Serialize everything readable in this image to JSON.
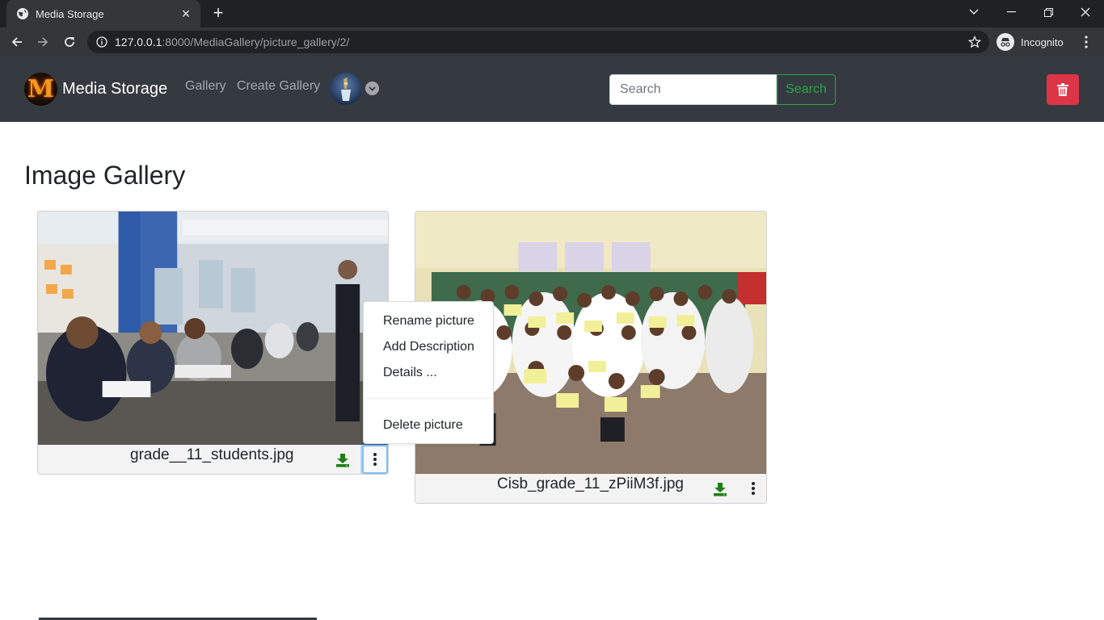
{
  "browser": {
    "tab_title": "Media Storage",
    "url_host": "127.0.0.1",
    "url_rest": ":8000/MediaGallery/picture_gallery/2/",
    "incognito_label": "Incognito"
  },
  "navbar": {
    "brand_letter": "M",
    "brand_name": "Media Storage",
    "links": [
      "Gallery",
      "Create Gallery"
    ],
    "search_placeholder": "Search",
    "search_button": "Search"
  },
  "page": {
    "title": "Image Gallery"
  },
  "gallery": {
    "cards": [
      {
        "filename": "grade__11_students.jpg"
      },
      {
        "filename": "Cisb_grade_11_zPiiM3f.jpg"
      }
    ]
  },
  "context_menu": {
    "items": [
      "Rename picture",
      "Add Description",
      "Details ...",
      "Delete picture"
    ]
  },
  "colors": {
    "navbar_bg": "#343a40",
    "success": "#28a745",
    "danger": "#dc3545",
    "download_icon": "#1e7e14"
  }
}
